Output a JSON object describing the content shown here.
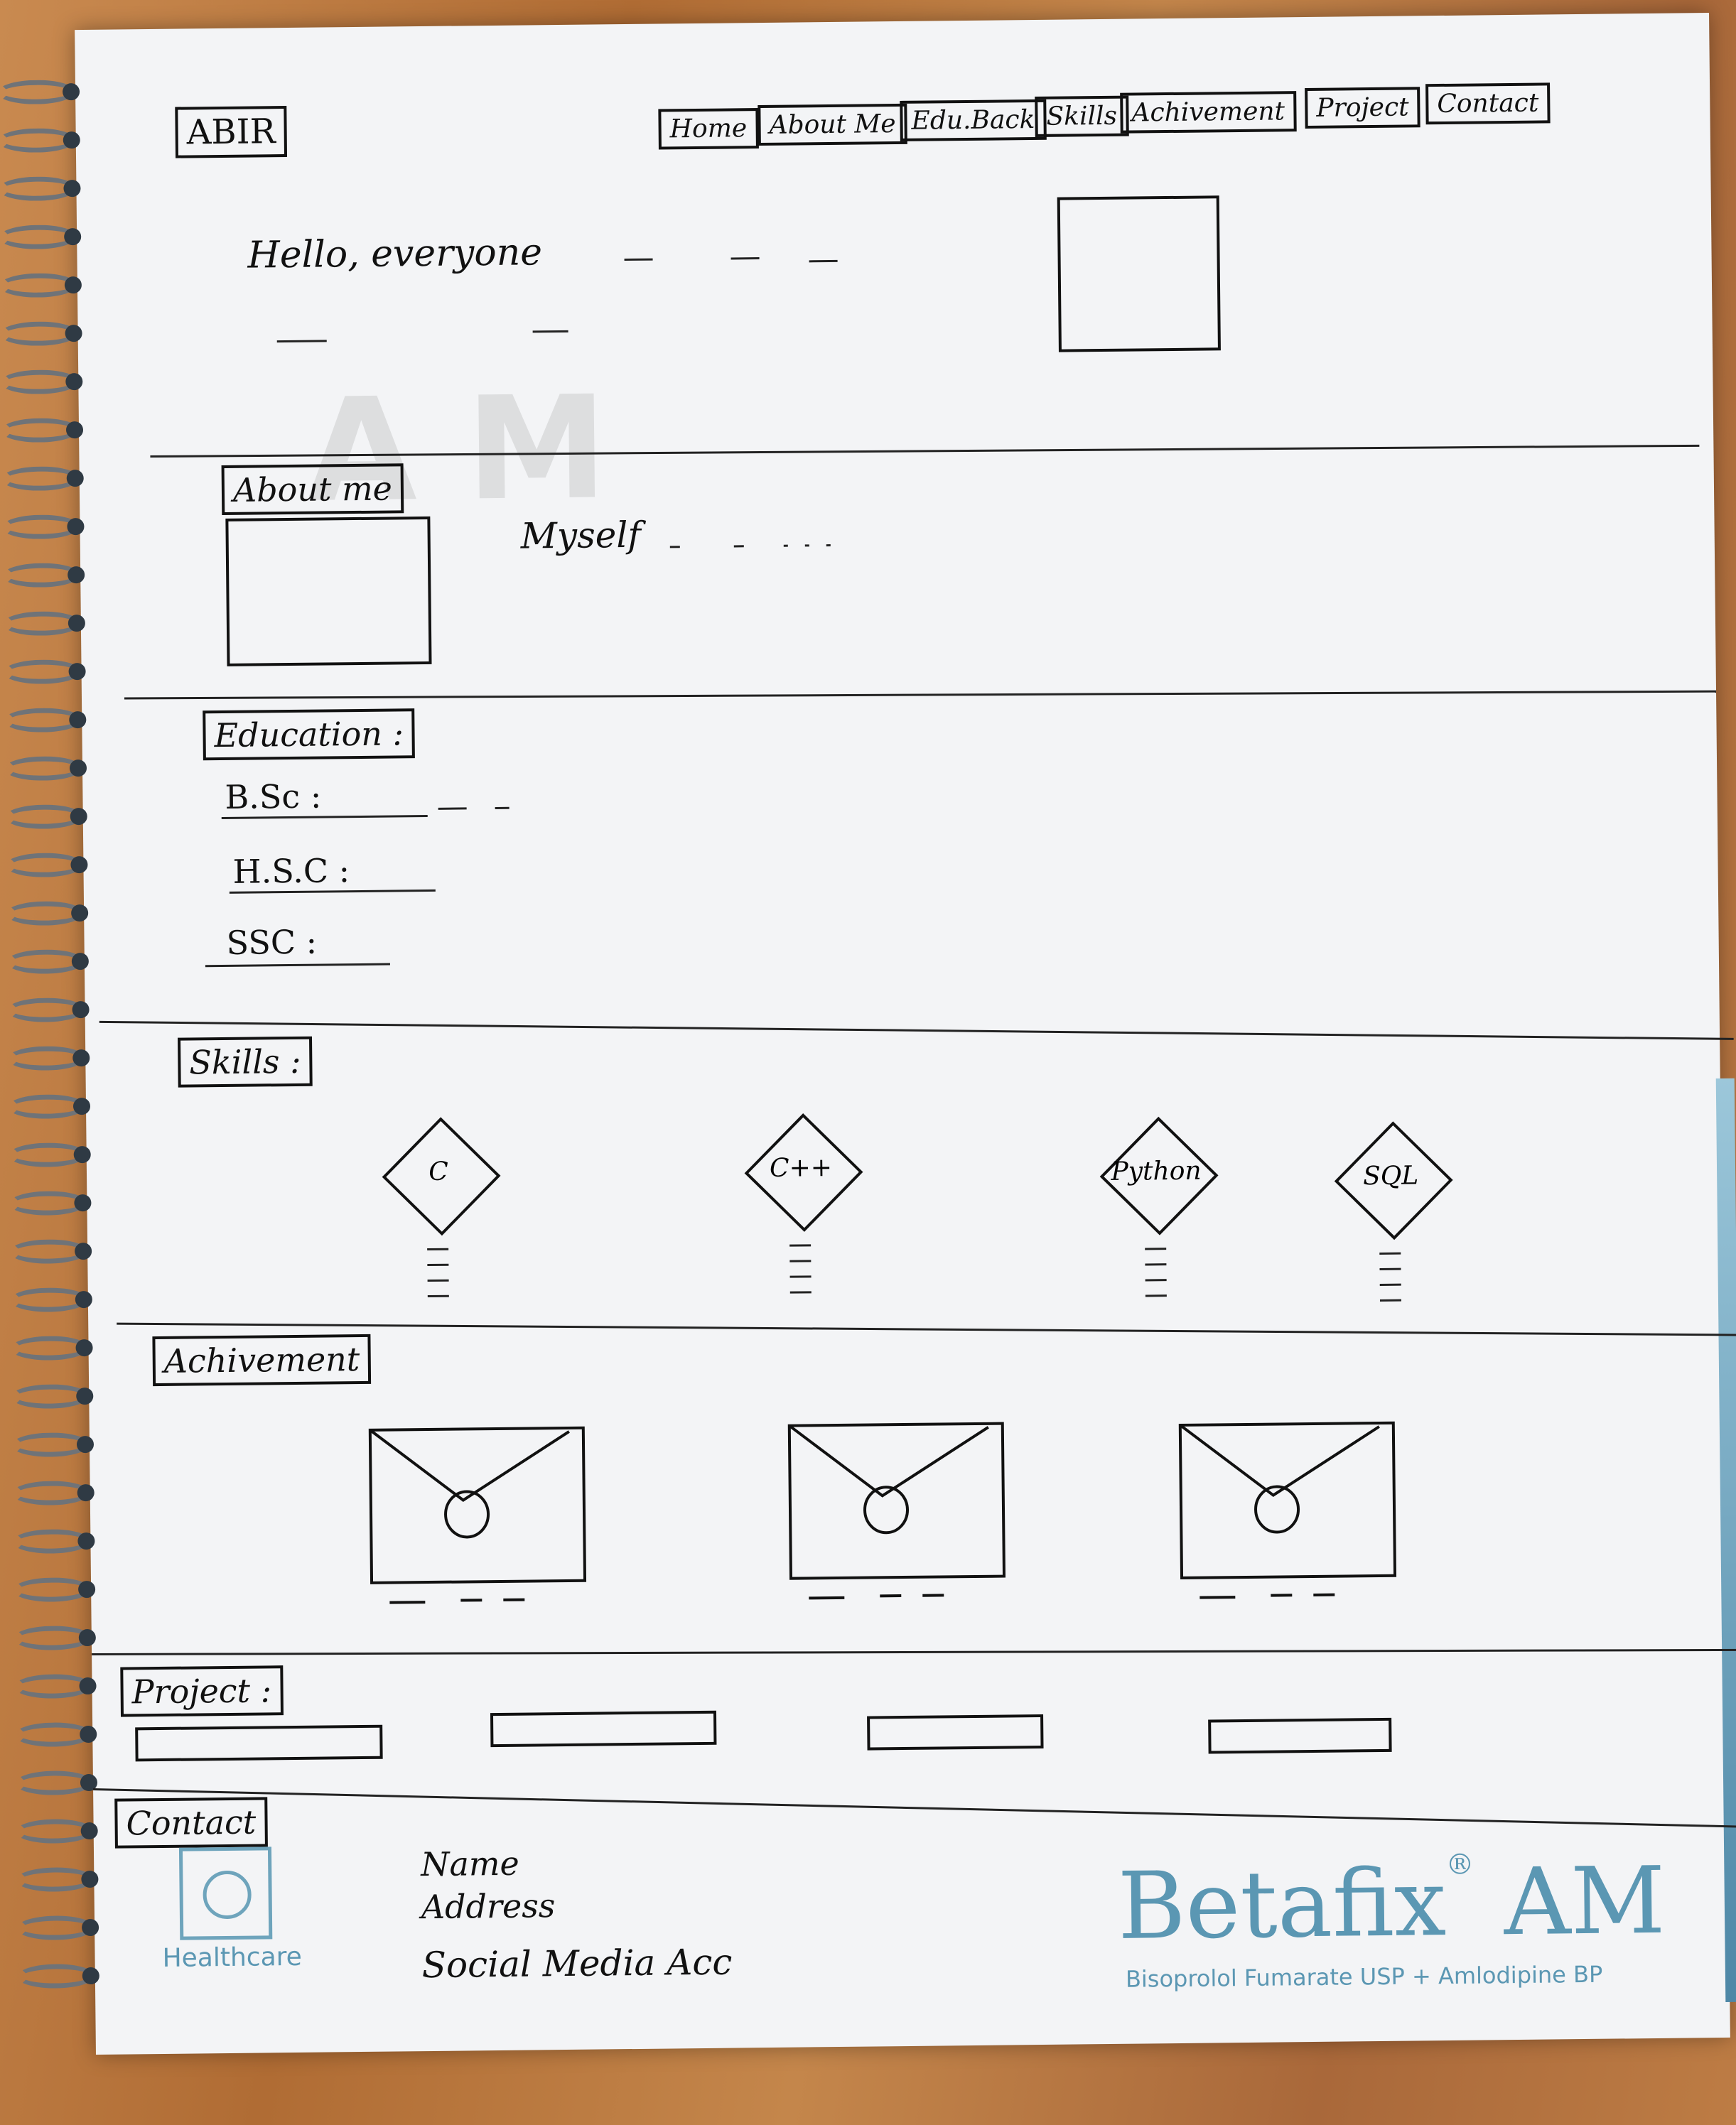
{
  "header": {
    "brand": "ABIR",
    "nav": [
      "Home",
      "About Me",
      "Edu.Back",
      "Skills",
      "Achivement",
      "Project",
      "Contact"
    ]
  },
  "hero": {
    "greeting": "Hello, everyone"
  },
  "about": {
    "heading": "About me",
    "text": "Myself"
  },
  "education": {
    "heading": "Education :",
    "items": [
      "B.Sc :",
      "H.S.C :",
      "SSC :"
    ]
  },
  "skills": {
    "heading": "Skills :",
    "items": [
      "C",
      "C++",
      "Python",
      "SQL"
    ]
  },
  "achievement": {
    "heading": "Achivement"
  },
  "project": {
    "heading": "Project :"
  },
  "contact": {
    "heading": "Contact",
    "lines": [
      "Name",
      "Address",
      "Social Media Acc"
    ]
  },
  "print": {
    "logo_label": "Healthcare",
    "brand_name": "Betafix",
    "brand_suffix": "AM",
    "brand_sub": "Bisoprolol Fumarate USP + Amlodipine BP"
  },
  "colors": {
    "ink": "#111111",
    "paper": "#f3f4f6",
    "print_blue": "#5b97b3",
    "desk": "#b8773f"
  }
}
